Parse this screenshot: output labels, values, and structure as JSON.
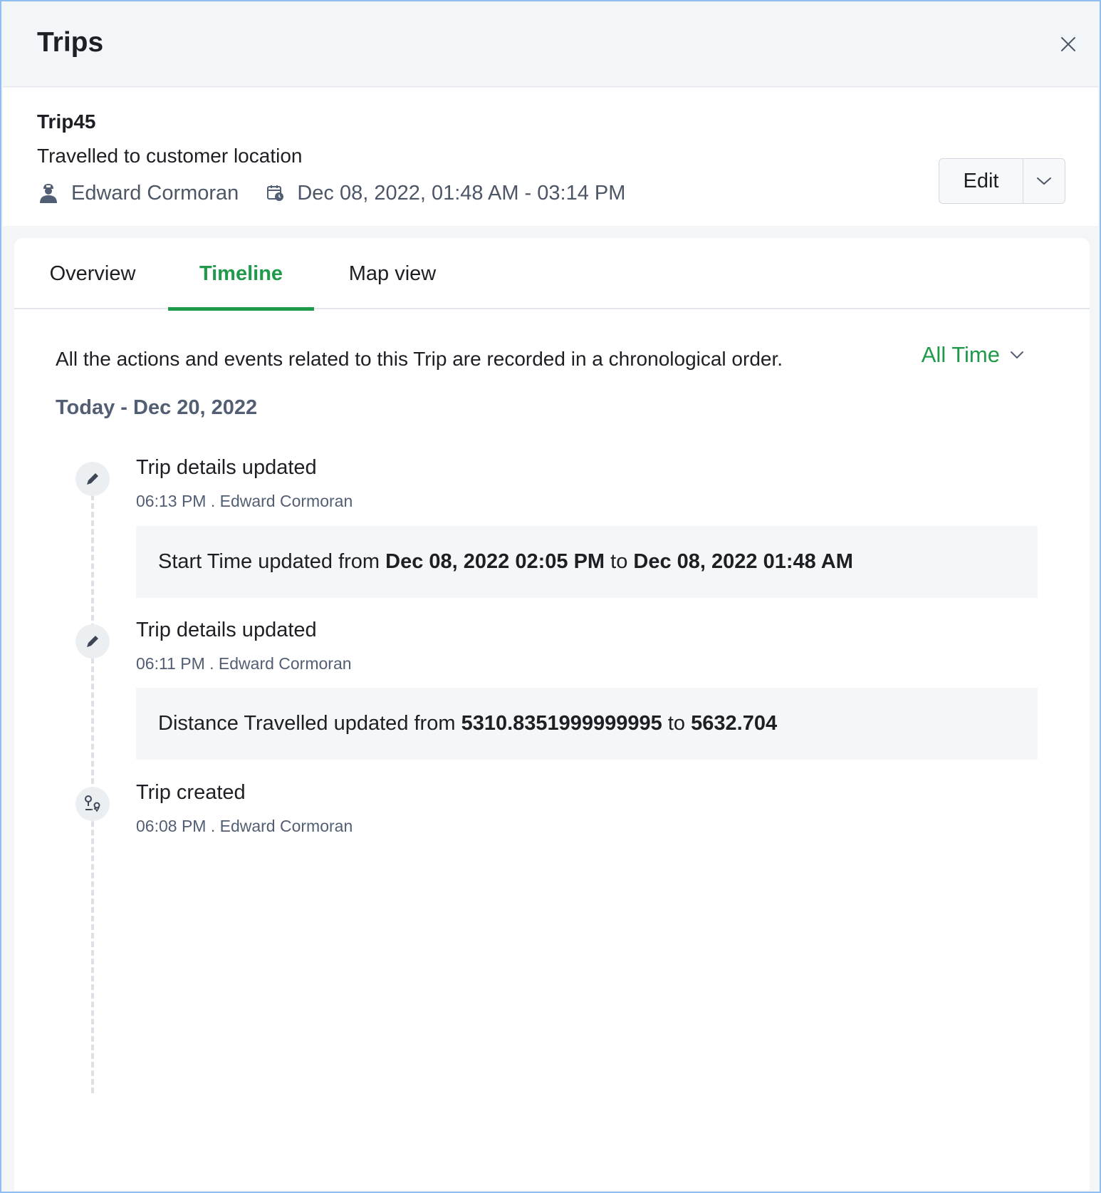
{
  "header": {
    "title": "Trips"
  },
  "trip": {
    "name": "Trip45",
    "description": "Travelled to customer location",
    "driver": "Edward Cormoran",
    "date_range": "Dec 08, 2022, 01:48 AM - 03:14 PM",
    "edit_label": "Edit"
  },
  "tabs": [
    {
      "label": "Overview",
      "active": false
    },
    {
      "label": "Timeline",
      "active": true
    },
    {
      "label": "Map view",
      "active": false
    }
  ],
  "timeline": {
    "intro": "All the actions and events related to this Trip are recorded in a chronological order.",
    "filter_label": "All Time",
    "date_group": "Today - Dec 20, 2022",
    "events": [
      {
        "icon": "pencil-icon",
        "title": "Trip details updated",
        "meta": "06:13 PM . Edward Cormoran",
        "detail": {
          "prefix": "Start Time updated from ",
          "from": "Dec 08, 2022 02:05 PM",
          "mid": " to ",
          "to": "Dec 08, 2022 01:48 AM"
        }
      },
      {
        "icon": "pencil-icon",
        "title": "Trip details updated",
        "meta": "06:11 PM . Edward Cormoran",
        "detail": {
          "prefix": "Distance Travelled updated from ",
          "from": "5310.8351999999995",
          "mid": " to ",
          "to": "5632.704"
        }
      },
      {
        "icon": "route-pin-icon",
        "title": "Trip created",
        "meta": "06:08 PM . Edward Cormoran"
      }
    ]
  },
  "colors": {
    "accent_green": "#1f9a4a",
    "muted_text": "#525e73",
    "border_blue": "#8fbef3"
  }
}
